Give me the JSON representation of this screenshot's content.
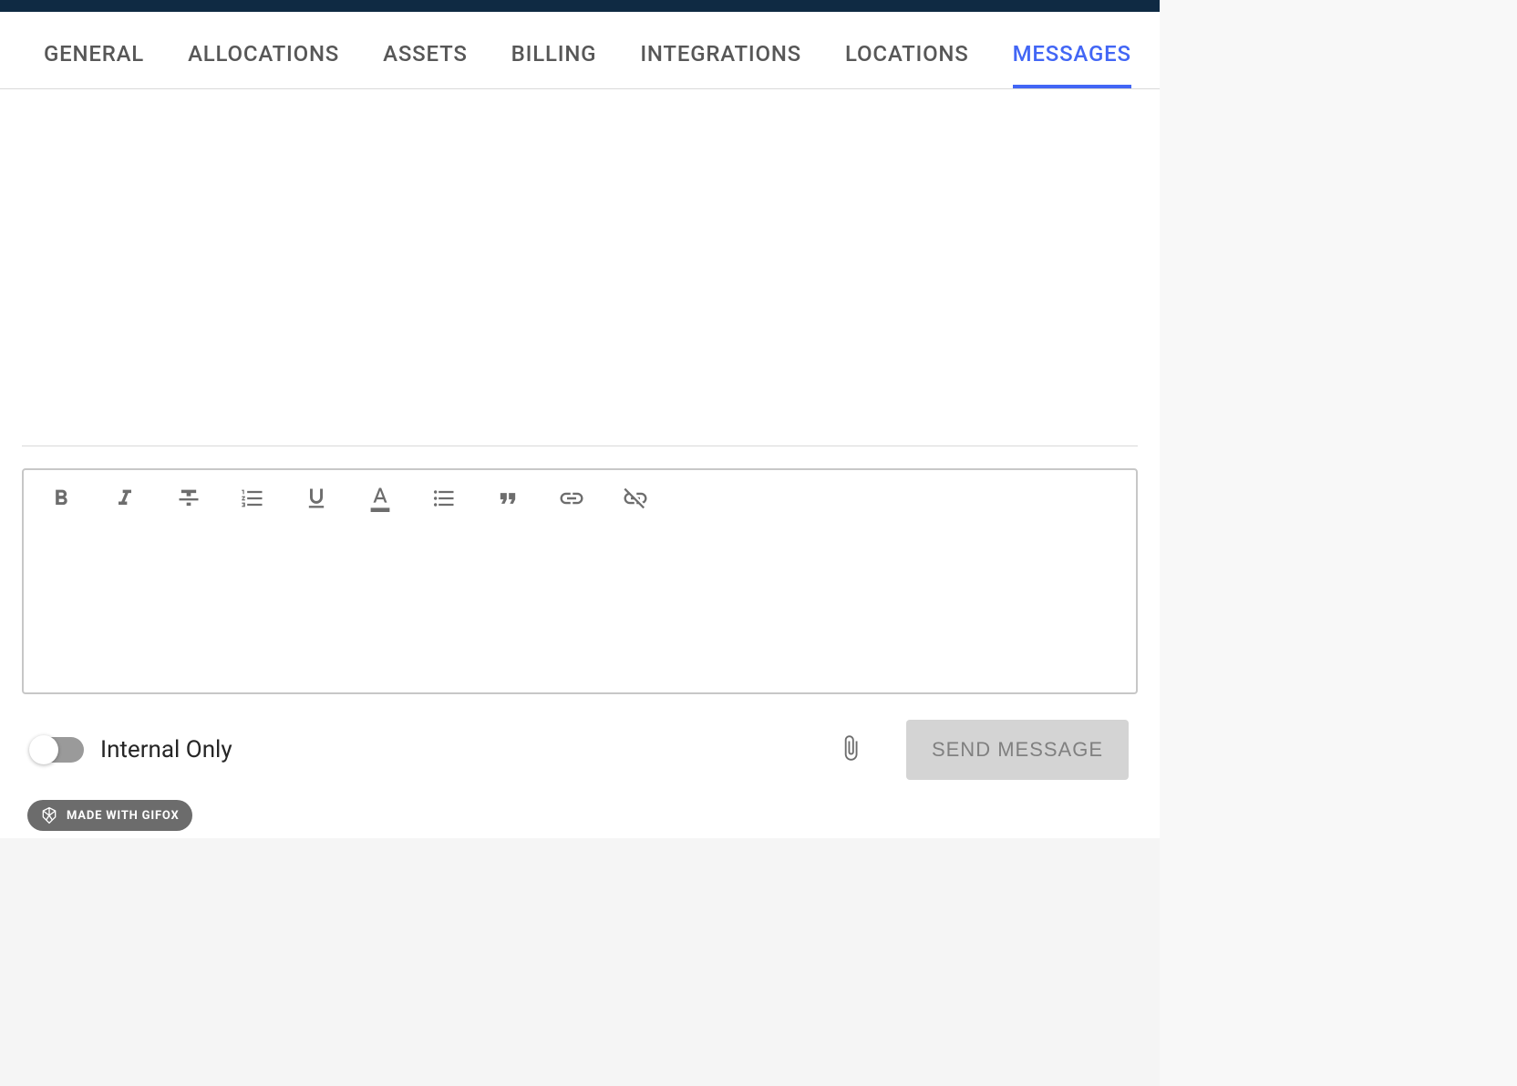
{
  "tabs": [
    {
      "label": "GENERAL",
      "active": false
    },
    {
      "label": "ALLOCATIONS",
      "active": false
    },
    {
      "label": "ASSETS",
      "active": false
    },
    {
      "label": "BILLING",
      "active": false
    },
    {
      "label": "INTEGRATIONS",
      "active": false
    },
    {
      "label": "LOCATIONS",
      "active": false
    },
    {
      "label": "MESSAGES",
      "active": true
    }
  ],
  "footer": {
    "toggle_label": "Internal Only",
    "toggle_on": false,
    "send_label": "SEND MESSAGE"
  },
  "badge": {
    "label": "MADE WITH GIFOX"
  }
}
